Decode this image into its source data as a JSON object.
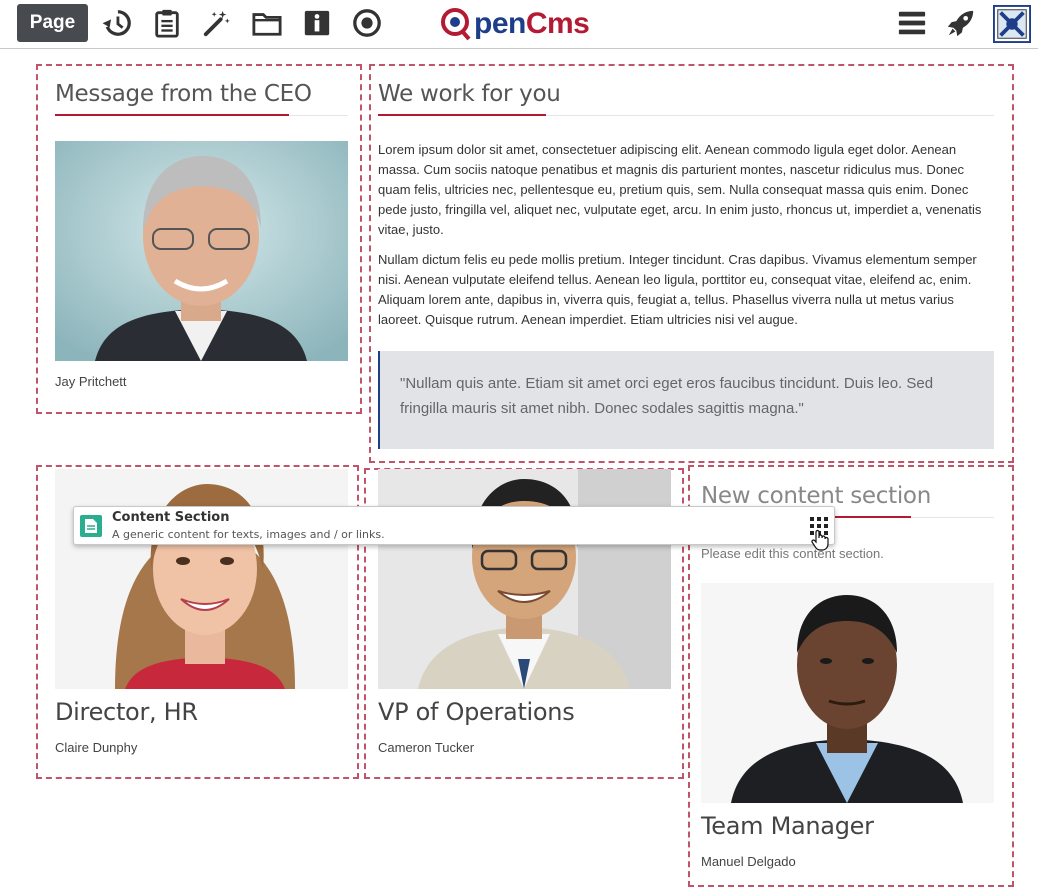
{
  "toolbar": {
    "page_button": "Page",
    "icons": [
      "history-icon",
      "clipboard-icon",
      "magic-wand-icon",
      "folder-icon",
      "info-icon",
      "target-icon"
    ],
    "logo_o": "O",
    "logo_pen": "pen",
    "logo_cms": "Cms",
    "right_icons": [
      "menu-icon",
      "rocket-icon",
      "publish-icon"
    ]
  },
  "ceo": {
    "title": "Message from the CEO",
    "name": "Jay Pritchett"
  },
  "work": {
    "title": "We work for you",
    "paragraph1": "Lorem ipsum dolor sit amet, consectetuer adipiscing elit. Aenean commodo ligula eget dolor. Aenean massa. Cum sociis natoque penatibus et magnis dis parturient montes, nascetur ridiculus mus. Donec quam felis, ultricies nec, pellentesque eu, pretium quis, sem. Nulla consequat massa quis enim. Donec pede justo, fringilla vel, aliquet nec, vulputate eget, arcu. In enim justo, rhoncus ut, imperdiet a, venenatis vitae, justo.",
    "paragraph2": "Nullam dictum felis eu pede mollis pretium. Integer tincidunt. Cras dapibus. Vivamus elementum semper nisi. Aenean vulputate eleifend tellus. Aenean leo ligula, porttitor eu, consequat vitae, eleifend ac, enim. Aliquam lorem ante, dapibus in, viverra quis, feugiat a, tellus. Phasellus viverra nulla ut metus varius laoreet. Quisque rutrum. Aenean imperdiet. Etiam ultricies nisi vel augue.",
    "quote": "\"Nullam quis ante. Etiam sit amet orci eget eros faucibus tincidunt. Duis leo. Sed fringilla mauris sit amet nibh. Donec sodales sagittis magna.\""
  },
  "team": [
    {
      "role": "Director, HR",
      "name": "Claire Dunphy"
    },
    {
      "role": "VP of Operations",
      "name": "Cameron Tucker"
    },
    {
      "role": "Team Manager",
      "name": "Manuel Delgado"
    }
  ],
  "new_section": {
    "title": "New content section",
    "placeholder": "Please edit this content section."
  },
  "drag_item": {
    "title": "Content Section",
    "description": "A generic content for texts, images and / or links."
  },
  "colors": {
    "accent": "#b31b34",
    "dashed": "#c0546b",
    "toolbar_button": "#474a4e",
    "quote_bg": "#e2e3e7",
    "quote_border": "#1f3e8a",
    "drag_icon": "#2bae8f"
  }
}
